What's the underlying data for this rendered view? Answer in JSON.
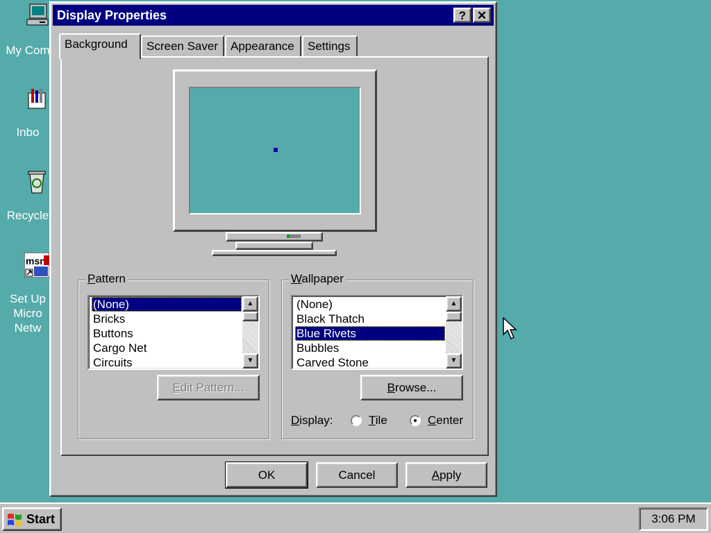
{
  "desktop": {
    "background": "#55aaaa",
    "icons": [
      {
        "label": "My Com",
        "icon": "computer-icon"
      },
      {
        "label": "Inbo",
        "icon": "inbox-icon"
      },
      {
        "label": "Recycle",
        "icon": "recycle-bin-icon"
      },
      {
        "label_lines": [
          "Set Up",
          "Micro",
          "Netw"
        ],
        "icon": "msn-icon"
      }
    ]
  },
  "window": {
    "title": "Display Properties",
    "help_glyph": "?",
    "close_glyph": "✕",
    "tabs": [
      {
        "label": "Background",
        "active": true
      },
      {
        "label": "Screen Saver",
        "active": false
      },
      {
        "label": "Appearance",
        "active": false
      },
      {
        "label": "Settings",
        "active": false
      }
    ],
    "preview": {
      "screen_color": "#55aaaa",
      "rivet_color": "#0000aa"
    },
    "pattern": {
      "title_hotkey": "P",
      "title_rest": "attern",
      "items": [
        "(None)",
        "Bricks",
        "Buttons",
        "Cargo Net",
        "Circuits"
      ],
      "selected": "(None)",
      "edit_button_hotkey": "E",
      "edit_button_rest": "dit Pattern...",
      "edit_button_enabled": false
    },
    "wallpaper": {
      "title_hotkey": "W",
      "title_rest": "allpaper",
      "items": [
        "(None)",
        "Black Thatch",
        "Blue Rivets",
        "Bubbles",
        "Carved Stone"
      ],
      "selected": "Blue Rivets",
      "browse_hotkey": "B",
      "browse_rest": "rowse...",
      "display_hotkey": "D",
      "display_rest": "isplay:",
      "tile_hotkey": "T",
      "tile_rest": "ile",
      "center_hotkey": "C",
      "center_rest": "enter",
      "display_mode": "center"
    },
    "buttons": {
      "ok": "OK",
      "cancel": "Cancel",
      "apply_hotkey": "A",
      "apply_rest": "pply"
    }
  },
  "taskbar": {
    "start_label": "Start",
    "clock": "3:06 PM"
  },
  "colors": {
    "title_bar": "#000080",
    "face": "#c0c0c0",
    "selection": "#000080"
  }
}
